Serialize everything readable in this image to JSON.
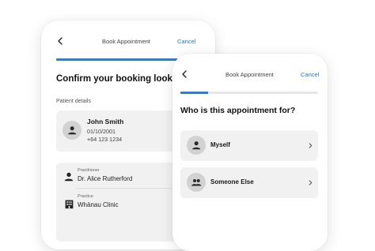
{
  "back_screen": {
    "header": {
      "title": "Book Appointment",
      "cancel_label": "Cancel",
      "progress": 1.0
    },
    "heading": "Confirm your booking looks go",
    "patient_section_label": "Patient details",
    "patient": {
      "name": "John Smith",
      "dob": "01/10/2001",
      "phone": "+64 123 1234"
    },
    "details": {
      "practitioner_label": "Practitioner",
      "practitioner_value": "Dr. Alice Rutherford",
      "practice_label": "Practice",
      "practice_value": "Whānau Clinic"
    }
  },
  "front_screen": {
    "header": {
      "title": "Book Appointment",
      "cancel_label": "Cancel",
      "progress": 0.2
    },
    "heading": "Who is this appointment for?",
    "options": [
      {
        "label": "Myself",
        "icon": "person-icon"
      },
      {
        "label": "Someone Else",
        "icon": "people-icon"
      }
    ]
  },
  "colors": {
    "accent": "#1f78d1",
    "progress": "#2f7fd0",
    "card": "#f1f1f1",
    "avatar": "#d2d2d2"
  }
}
